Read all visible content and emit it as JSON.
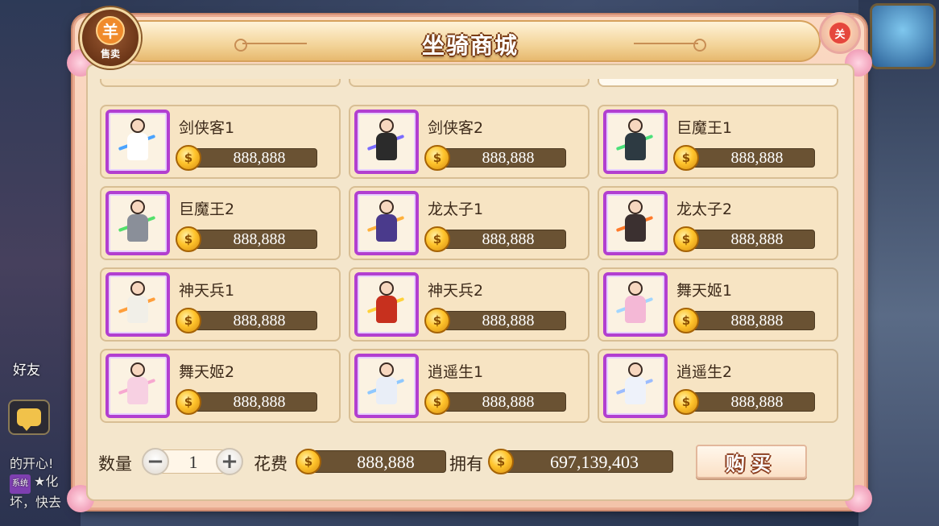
{
  "background": {
    "friend_label": "好友",
    "chat_lines": [
      "的开心!",
      "★化",
      "坏，快去"
    ],
    "system_tag": "系统"
  },
  "dialog": {
    "title": "坐骑商城",
    "sell_label": "售卖",
    "sell_glyph": "羊",
    "close_glyph": "关"
  },
  "coin_glyph": "$",
  "items": [
    {
      "name": "剑侠客1",
      "price": "888,888",
      "color": "#ffffff",
      "weapon": "#4aa3ff"
    },
    {
      "name": "剑侠客2",
      "price": "888,888",
      "color": "#2b2b2b",
      "weapon": "#7a6cff"
    },
    {
      "name": "巨魔王1",
      "price": "888,888",
      "color": "#2d3a42",
      "weapon": "#4be07a"
    },
    {
      "name": "巨魔王2",
      "price": "888,888",
      "color": "#8a8f99",
      "weapon": "#53e06b"
    },
    {
      "name": "龙太子1",
      "price": "888,888",
      "color": "#4a3a8c",
      "weapon": "#ffb13b"
    },
    {
      "name": "龙太子2",
      "price": "888,888",
      "color": "#3b3030",
      "weapon": "#ff7a2a"
    },
    {
      "name": "神天兵1",
      "price": "888,888",
      "color": "#f1efe8",
      "weapon": "#ff9e3a"
    },
    {
      "name": "神天兵2",
      "price": "888,888",
      "color": "#c7301e",
      "weapon": "#ffd23a"
    },
    {
      "name": "舞天姬1",
      "price": "888,888",
      "color": "#f4b8d6",
      "weapon": "#a2d6ff"
    },
    {
      "name": "舞天姬2",
      "price": "888,888",
      "color": "#f7d0e2",
      "weapon": "#f7a8d0"
    },
    {
      "name": "逍遥生1",
      "price": "888,888",
      "color": "#e9eef7",
      "weapon": "#8fc8ff"
    },
    {
      "name": "逍遥生2",
      "price": "888,888",
      "color": "#eef2fa",
      "weapon": "#9bbcff"
    }
  ],
  "footer": {
    "quantity_label": "数量",
    "quantity": "1",
    "minus": "−",
    "plus": "+",
    "cost_label": "花费",
    "cost": "888,888",
    "owned_label": "拥有",
    "owned": "697,139,403",
    "buy_label": "购买"
  },
  "colors": {
    "thumb_border": "#b23fd0",
    "price_bar": "#6a5233",
    "accent_title_outline": "#7a3d16"
  }
}
